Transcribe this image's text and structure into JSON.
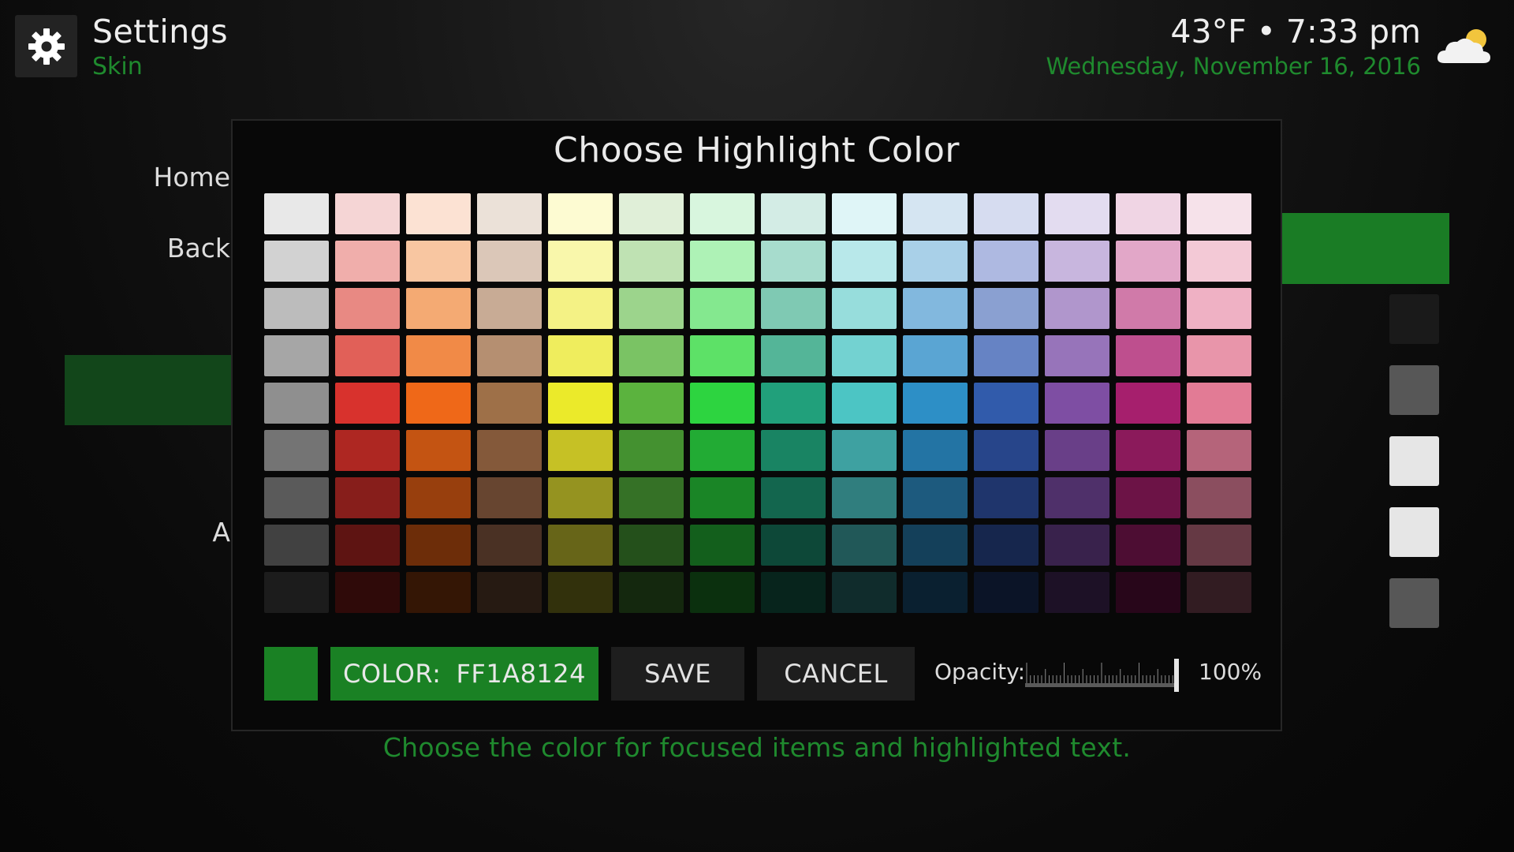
{
  "header": {
    "title": "Settings",
    "subtitle": "Skin",
    "time": "43°F • 7:33 pm",
    "date": "Wednesday, November 16, 2016",
    "settings_icon": "gear-icon",
    "weather_icon": "partly-cloudy-icon"
  },
  "background_menu": {
    "items": [
      "Home",
      "Back",
      "A"
    ]
  },
  "side_swatches": [
    "#1a7c25",
    "#1a1a1a",
    "#575757",
    "#e6e6e6",
    "#e6e6e6",
    "#575757"
  ],
  "dialog": {
    "title": "Choose Highlight Color",
    "palette": [
      [
        "#e8e8e8",
        "#f5d5d5",
        "#fce2d3",
        "#ebe1d8",
        "#fdfbd2",
        "#e0efd8",
        "#d8f6de",
        "#d3ece5",
        "#dff5f7",
        "#d5e5f2",
        "#d6dcf0",
        "#e3dcf0",
        "#f0d5e4",
        "#f6e2ea"
      ],
      [
        "#d2d2d2",
        "#f0aeab",
        "#f8c6a1",
        "#dbc7b8",
        "#f9f7ab",
        "#bfe2b3",
        "#aef2b6",
        "#a7dccd",
        "#b8e8ea",
        "#a9d0e8",
        "#aeb9e1",
        "#c8b6de",
        "#e2a7c8",
        "#f3c9d6"
      ],
      [
        "#bcbcbc",
        "#e88983",
        "#f4aa73",
        "#c8ab95",
        "#f4f285",
        "#9cd48c",
        "#84e88f",
        "#7fc9b3",
        "#97dddc",
        "#82b8de",
        "#8aa0d1",
        "#b096cc",
        "#d07aa9",
        "#efb1c4"
      ],
      [
        "#a6a6a6",
        "#e16058",
        "#f18a47",
        "#b58f71",
        "#efed5d",
        "#7ac364",
        "#5de167",
        "#54b598",
        "#73d2d1",
        "#5aa5d3",
        "#6683c4",
        "#9774ba",
        "#be4f8e",
        "#e895aa"
      ],
      [
        "#8f8f8f",
        "#d8322d",
        "#ef6818",
        "#9e7048",
        "#ebea2a",
        "#5bb33e",
        "#2dd440",
        "#21a07b",
        "#4cc5c4",
        "#2d8fc6",
        "#315bab",
        "#7e4ea3",
        "#a61f6d",
        "#e27b95"
      ],
      [
        "#747474",
        "#ae2722",
        "#c45412",
        "#84593a",
        "#c6c125",
        "#449130",
        "#22ab34",
        "#198463",
        "#3ea1a1",
        "#2374a4",
        "#27458a",
        "#693f88",
        "#8b1a5b",
        "#b5647a"
      ],
      [
        "#5a5a5a",
        "#871e1b",
        "#983f0d",
        "#674530",
        "#959320",
        "#357126",
        "#1a8526",
        "#13664e",
        "#307e7e",
        "#1d5a7e",
        "#1f356c",
        "#4f306a",
        "#6c1346",
        "#8b4e5f"
      ],
      [
        "#414141",
        "#5e1412",
        "#6d2d09",
        "#4a3124",
        "#676518",
        "#24501b",
        "#135f1c",
        "#0d4838",
        "#215858",
        "#14405a",
        "#16264d",
        "#39224c",
        "#4d0d33",
        "#653944"
      ],
      [
        "#1c1c1c",
        "#2f0a09",
        "#341605",
        "#261a12",
        "#32310c",
        "#14280e",
        "#0b300e",
        "#07241c",
        "#102c2c",
        "#0a2030",
        "#0b1427",
        "#1d1126",
        "#28061a",
        "#321c22"
      ]
    ],
    "selected_color": "#1a8124",
    "color_label": "COLOR:",
    "color_value": "FF1A8124",
    "save_label": "SAVE",
    "cancel_label": "CANCEL",
    "opacity_label": "Opacity:",
    "opacity_value": "100%",
    "opacity_fraction": 1.0
  },
  "hint": "Choose the color for focused items and highlighted text."
}
